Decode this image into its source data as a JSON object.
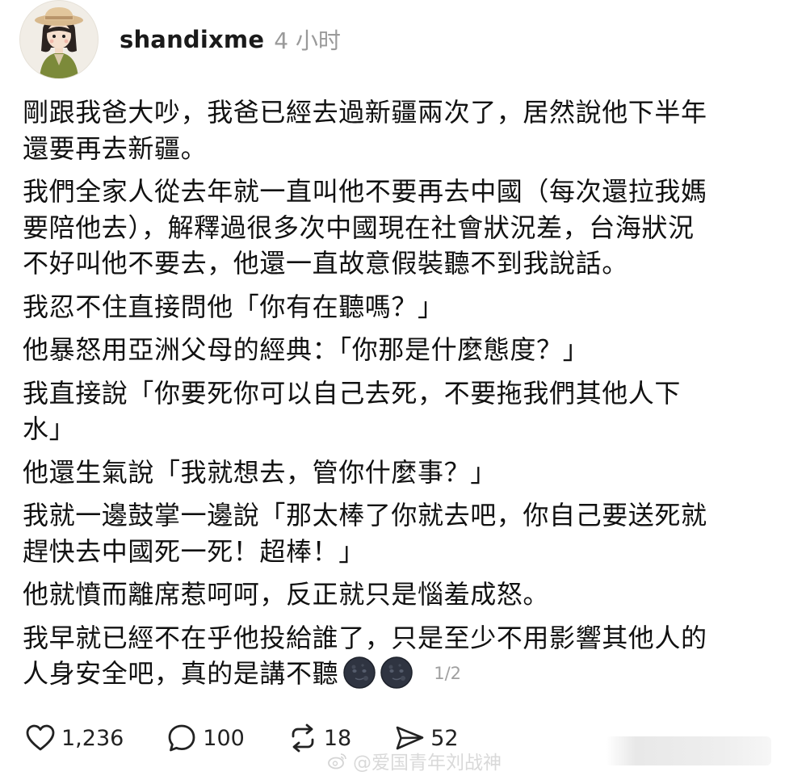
{
  "post": {
    "username": "shandixme",
    "time": "4 小时",
    "paragraphs": [
      "剛跟我爸大吵，我爸已經去過新疆兩次了，居然說他下半年\n還要再去新疆。",
      "我們全家人從去年就一直叫他不要再去中國（每次還拉我媽\n要陪他去），解釋過很多次中國現在社會狀況差，台海狀況\n不好叫他不要去，他還一直故意假裝聽不到我說話。",
      "我忍不住直接問他「你有在聽嗎？」",
      "他暴怒用亞洲父母的經典：「你那是什麼態度？」",
      "我直接說「你要死你可以自己去死，不要拖我們其他人下\n水」",
      "他還生氣說「我就想去，管你什麼事？」",
      "我就一邊鼓掌一邊說「那太棒了你就去吧，你自己要送死就\n趕快去中國死一死！超棒！」",
      "他就憤而離席惹呵呵，反正就只是惱羞成怒。",
      "我早就已經不在乎他投給誰了，只是至少不用影響其他人的\n人身安全吧，真的是講不聽"
    ],
    "emojis": [
      "new-moon-face",
      "new-moon-face"
    ],
    "page_indicator": "1/2"
  },
  "actions": {
    "likes": "1,236",
    "comments": "100",
    "reposts": "18",
    "shares": "52"
  },
  "watermark": {
    "text": "@爱国青年刘战神"
  },
  "colors": {
    "moon_face": "#2f3441",
    "avatar_bg": "#f1ede6",
    "meta_gray": "#9a9a9a"
  }
}
